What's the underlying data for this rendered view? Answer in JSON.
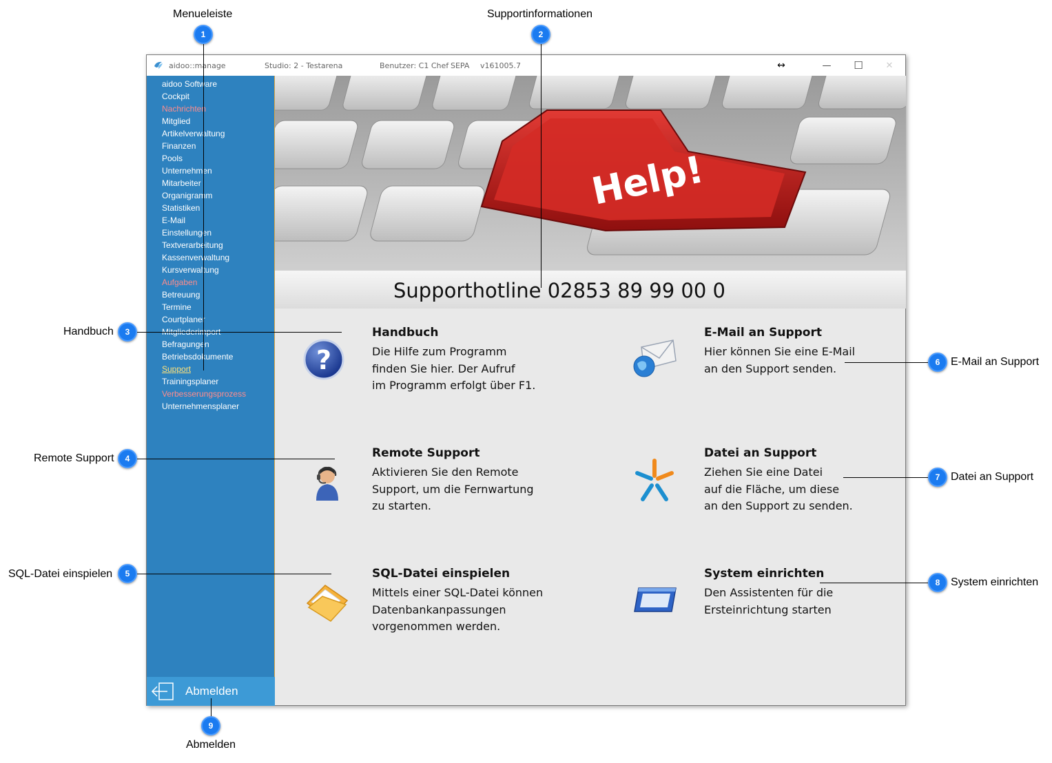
{
  "callouts": {
    "menueleiste": {
      "number": "1",
      "label": "Menueleiste"
    },
    "supportinfo": {
      "number": "2",
      "label": "Supportinformationen"
    },
    "handbuch": {
      "number": "3",
      "label": "Handbuch"
    },
    "remote": {
      "number": "4",
      "label": "Remote Support"
    },
    "sql": {
      "number": "5",
      "label": "SQL-Datei einspielen"
    },
    "email": {
      "number": "6",
      "label": "E-Mail an Support"
    },
    "datei": {
      "number": "7",
      "label": "Datei an Support"
    },
    "system": {
      "number": "8",
      "label": "System einrichten"
    },
    "abmelden": {
      "number": "9",
      "label": "Abmelden"
    }
  },
  "titlebar": {
    "app_name": "aidoo::manage",
    "studio": "Studio: 2 - Testarena",
    "user": "Benutzer: C1 Chef",
    "mode": "SEPA",
    "version": "v161005.7",
    "resize_glyph": "↔",
    "minimize_glyph": "—",
    "maximize_glyph": "☐",
    "close_glyph": "✕"
  },
  "sidebar": {
    "items": [
      {
        "label": "aidoo Software",
        "state": "normal"
      },
      {
        "label": "Cockpit",
        "state": "normal"
      },
      {
        "label": "Nachrichten",
        "state": "red"
      },
      {
        "label": "Mitglied",
        "state": "normal"
      },
      {
        "label": "Artikelverwaltung",
        "state": "normal"
      },
      {
        "label": "Finanzen",
        "state": "normal"
      },
      {
        "label": "Pools",
        "state": "normal"
      },
      {
        "label": "Unternehmen",
        "state": "normal"
      },
      {
        "label": "Mitarbeiter",
        "state": "normal"
      },
      {
        "label": "Organigramm",
        "state": "normal"
      },
      {
        "label": "Statistiken",
        "state": "normal"
      },
      {
        "label": "E-Mail",
        "state": "normal"
      },
      {
        "label": "Einstellungen",
        "state": "normal"
      },
      {
        "label": "Textverarbeitung",
        "state": "normal"
      },
      {
        "label": "Kassenverwaltung",
        "state": "normal"
      },
      {
        "label": "Kursverwaltung",
        "state": "normal"
      },
      {
        "label": "Aufgaben",
        "state": "red"
      },
      {
        "label": "Betreuung",
        "state": "normal"
      },
      {
        "label": "Termine",
        "state": "normal"
      },
      {
        "label": "Courtplaner",
        "state": "normal"
      },
      {
        "label": "Mitgliederimport",
        "state": "normal"
      },
      {
        "label": "Befragungen",
        "state": "normal"
      },
      {
        "label": "Betriebsdokumente",
        "state": "normal"
      },
      {
        "label": "Support",
        "state": "active"
      },
      {
        "label": "Trainingsplaner",
        "state": "normal"
      },
      {
        "label": "Verbesserungsprozess",
        "state": "red"
      },
      {
        "label": "Unternehmensplaner",
        "state": "normal"
      }
    ],
    "logout_label": "Abmelden"
  },
  "banner": {
    "key_text": "Help!"
  },
  "hotline": "Supporthotline 02853 89 99 00 0",
  "cards": {
    "handbuch": {
      "title": "Handbuch",
      "desc": "Die Hilfe zum Programm\nfinden Sie hier. Der Aufruf\nim Programm erfolgt über F1."
    },
    "email": {
      "title": "E-Mail an Support",
      "desc": "Hier können Sie eine E-Mail\nan den Support senden."
    },
    "remote": {
      "title": "Remote Support",
      "desc": "Aktivieren Sie den Remote\nSupport, um die Fernwartung\nzu starten."
    },
    "datei": {
      "title": "Datei an Support",
      "desc": "Ziehen Sie eine Datei\nauf die Fläche, um diese\nan den Support zu senden."
    },
    "sql": {
      "title": "SQL-Datei einspielen",
      "desc": "Mittels einer SQL-Datei können\nDatenbankanpassungen\nvorgenommen werden."
    },
    "system": {
      "title": "System einrichten",
      "desc": "Den Assistenten für die\nErsteinrichtung starten"
    }
  },
  "colors": {
    "sidebar_bg": "#2e82bf",
    "logout_bg": "#3d9ad6",
    "menu_red": "#ff8c8c",
    "menu_active": "#ffe27a",
    "badge": "#1b7bf0",
    "content_bg": "#e9e9e9"
  },
  "icons": {
    "handbuch": "help-question-icon",
    "email": "email-globe-icon",
    "remote": "remote-support-agent-icon",
    "datei": "file-transfer-star-icon",
    "sql": "folder-sql-icon",
    "system": "system-setup-window-icon",
    "logout": "logout-arrow-icon"
  }
}
